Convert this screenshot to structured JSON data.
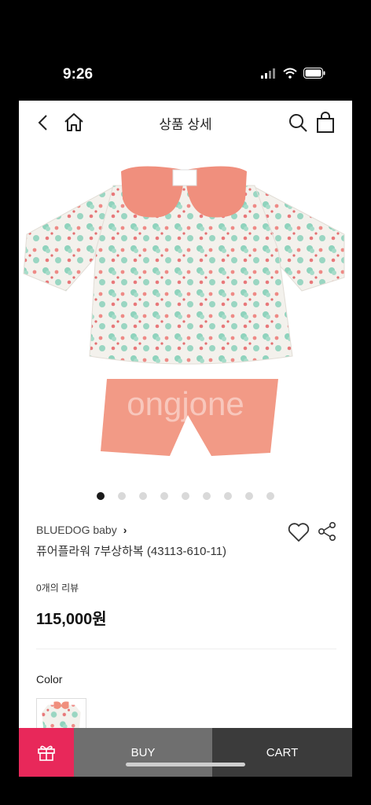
{
  "status_bar": {
    "time": "9:26"
  },
  "header": {
    "title": "상품 상세"
  },
  "product": {
    "image_watermark": "ongjone",
    "carousel": {
      "total": 9,
      "active_index": 0
    },
    "brand": "BLUEDOG baby",
    "brand_chevron": "›",
    "name": "퓨어플라워 7부상하복 (43113-610-11)",
    "reviews": "0개의 리뷰",
    "price": "115,000원"
  },
  "options": {
    "color_label": "Color"
  },
  "bottom_bar": {
    "buy_label": "BUY",
    "cart_label": "CART"
  },
  "colors": {
    "accent": "#e8285a",
    "buy_bg": "#6f6f6f",
    "cart_bg": "#3b3b3b",
    "collar": "#f08f7d",
    "pants": "#f29a86"
  },
  "icons": [
    "back-icon",
    "home-icon",
    "search-icon",
    "bag-icon",
    "heart-icon",
    "share-icon",
    "gift-icon"
  ]
}
